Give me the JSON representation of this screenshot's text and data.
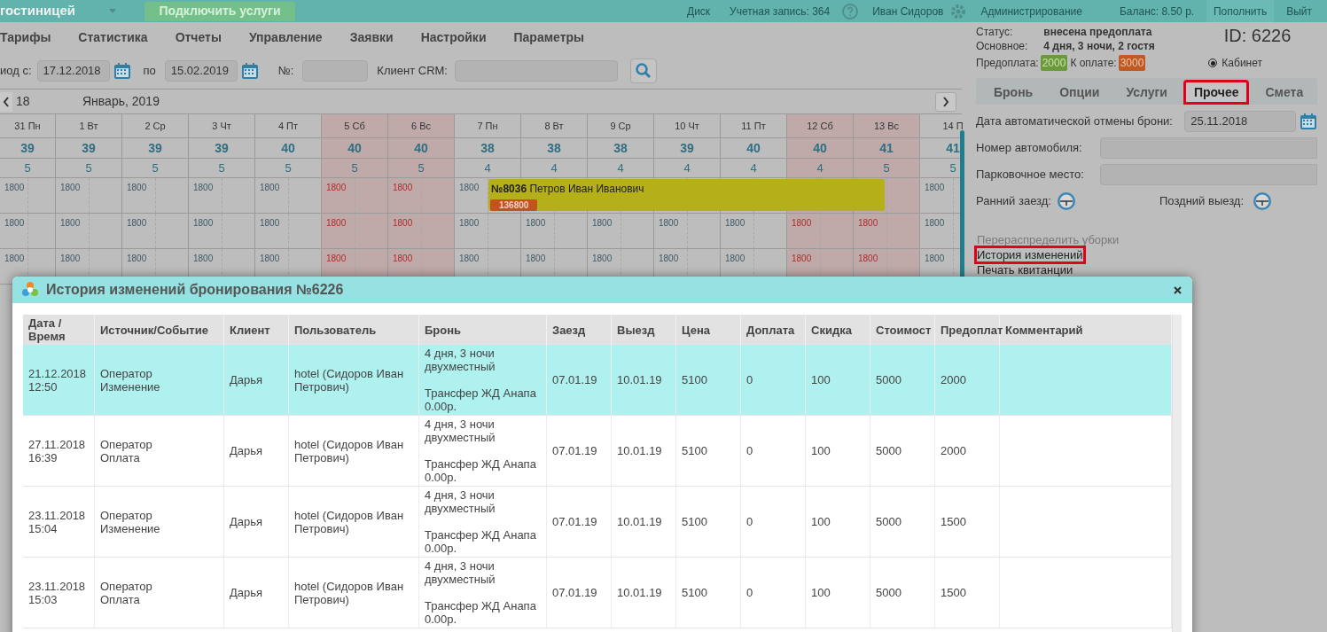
{
  "top_bar": {
    "title": "гостиницей",
    "connect_button": "Подключить услуги",
    "disk": "Диск",
    "account": "Учетная запись: 364",
    "user": "Иван Сидоров",
    "admin": "Администрирование",
    "balance": "Баланс: 8.50 р.",
    "top_up": "Пополнить",
    "logout": "Выйт"
  },
  "menu": [
    "Тарифы",
    "Статистика",
    "Отчеты",
    "Управление",
    "Заявки",
    "Настройки",
    "Параметры"
  ],
  "filter": {
    "period_label": "иод с:",
    "date_from": "17.12.2018",
    "to_label": "по",
    "date_to": "15.02.2019",
    "number_label": "№:",
    "crm_label": "Клиент CRM:"
  },
  "calendar": {
    "year_cut": "18",
    "month": "Январь, 2019",
    "days": [
      {
        "label": "31 Пн",
        "weekend": false,
        "count": "39",
        "free": "5"
      },
      {
        "label": "1 Вт",
        "weekend": false,
        "count": "39",
        "free": "5"
      },
      {
        "label": "2 Ср",
        "weekend": false,
        "count": "39",
        "free": "5"
      },
      {
        "label": "3 Чт",
        "weekend": false,
        "count": "39",
        "free": "5"
      },
      {
        "label": "4 Пт",
        "weekend": false,
        "count": "40",
        "free": "5"
      },
      {
        "label": "5 Сб",
        "weekend": true,
        "count": "40",
        "free": "5"
      },
      {
        "label": "6 Вс",
        "weekend": true,
        "count": "40",
        "free": "5"
      },
      {
        "label": "7 Пн",
        "weekend": false,
        "count": "38",
        "free": "4"
      },
      {
        "label": "8 Вт",
        "weekend": false,
        "count": "38",
        "free": "4"
      },
      {
        "label": "9 Ср",
        "weekend": false,
        "count": "38",
        "free": "4"
      },
      {
        "label": "10 Чт",
        "weekend": false,
        "count": "39",
        "free": "4"
      },
      {
        "label": "11 Пт",
        "weekend": false,
        "count": "40",
        "free": "4"
      },
      {
        "label": "12 Сб",
        "weekend": true,
        "count": "40",
        "free": "4"
      },
      {
        "label": "13 Вс",
        "weekend": true,
        "count": "41",
        "free": "5"
      },
      {
        "label": "14 П",
        "weekend": false,
        "count": "41",
        "free": "5"
      }
    ],
    "price_rows": [
      [
        "1800",
        "1800",
        "1800",
        "1800",
        "1800",
        "1800",
        "1800",
        "1800",
        null,
        null,
        null,
        null,
        null,
        null,
        "1800"
      ],
      [
        "1800",
        "1800",
        "1800",
        "1800",
        "1800",
        "1800",
        "1800",
        "1800",
        "1800",
        "1800",
        "1800",
        "1800",
        "1800",
        "1800",
        "1800"
      ],
      [
        "1800",
        "1800",
        "1800",
        "1800",
        "1800",
        "1800",
        "1800",
        "1800",
        "1800",
        "1800",
        "1800",
        "1800",
        "1800",
        "1800",
        "1800"
      ]
    ],
    "booking": {
      "number": "№8036",
      "guest": "Петров Иван Иванович",
      "amount": "136800"
    }
  },
  "side_panel": {
    "status_label": "Статус:",
    "status": "внесена предоплата",
    "main_label": "Основное:",
    "main": "4 дня, 3 ночи, 2 гостя",
    "prepay_label": "Предоплата:",
    "prepay": "2000",
    "due_label": "К оплате:",
    "due": "3000",
    "id": "ID: 6226",
    "cabinet": {
      "label": "Кабинет",
      "selected": true
    },
    "tabs": [
      {
        "label": "Бронь",
        "selected": false,
        "highlighted": false
      },
      {
        "label": "Опции",
        "selected": false,
        "highlighted": false
      },
      {
        "label": "Услуги",
        "selected": false,
        "highlighted": false
      },
      {
        "label": "Прочее",
        "selected": true,
        "highlighted": true
      },
      {
        "label": "Смета",
        "selected": false,
        "highlighted": false
      }
    ],
    "cancel_label": "Дата автоматической отмены брони:",
    "cancel_date": "25.11.2018",
    "car_label": "Номер автомобиля:",
    "parking_label": "Парковочное место:",
    "early_label": "Ранний заезд:",
    "late_label": "Поздний выезд:",
    "links": [
      {
        "label": "Перераспределить уборки",
        "disabled": true,
        "highlighted": false
      },
      {
        "label": "История изменений",
        "disabled": false,
        "highlighted": true
      },
      {
        "label": "Печать квитанции",
        "disabled": false,
        "highlighted": false
      }
    ]
  },
  "dialog": {
    "title": "История изменений бронирования №6226",
    "columns": [
      "Дата / Время",
      "Источник/Событие",
      "Клиент",
      "Пользователь",
      "Бронь",
      "Заезд",
      "Выезд",
      "Цена",
      "Доплата",
      "Скидка",
      "Стоимост",
      "Предоплат",
      "Комментарий"
    ],
    "rows": [
      {
        "selected": true,
        "date": "21.12.2018",
        "time": "12:50",
        "source": "Оператор",
        "event": "Изменение",
        "client": "Дарья",
        "user": "hotel (Сидоров Иван Петрович)",
        "booking": [
          "4 дня, 3 ночи двухместный",
          "Трансфер ЖД Анапа 0.00р."
        ],
        "checkin": "07.01.19",
        "checkout": "10.01.19",
        "price": "5100",
        "surcharge": "0",
        "discount": "100",
        "cost": "5000",
        "prepay": "2000"
      },
      {
        "selected": false,
        "date": "27.11.2018",
        "time": "16:39",
        "source": "Оператор",
        "event": "Оплата",
        "client": "Дарья",
        "user": "hotel (Сидоров Иван Петрович)",
        "booking": [
          "4 дня, 3 ночи двухместный",
          "Трансфер ЖД Анапа 0.00р."
        ],
        "checkin": "07.01.19",
        "checkout": "10.01.19",
        "price": "5100",
        "surcharge": "0",
        "discount": "100",
        "cost": "5000",
        "prepay": "2000"
      },
      {
        "selected": false,
        "date": "23.11.2018",
        "time": "15:04",
        "source": "Оператор",
        "event": "Изменение",
        "client": "Дарья",
        "user": "hotel (Сидоров Иван Петрович)",
        "booking": [
          "4 дня, 3 ночи двухместный",
          "Трансфер ЖД Анапа 0.00р."
        ],
        "checkin": "07.01.19",
        "checkout": "10.01.19",
        "price": "5100",
        "surcharge": "0",
        "discount": "100",
        "cost": "5000",
        "prepay": "1500"
      },
      {
        "selected": false,
        "date": "23.11.2018",
        "time": "15:03",
        "source": "Оператор",
        "event": "Оплата",
        "client": "Дарья",
        "user": "hotel (Сидоров Иван Петрович)",
        "booking": [
          "4 дня, 3 ночи двухместный",
          "Трансфер ЖД Анапа 0.00р."
        ],
        "checkin": "07.01.19",
        "checkout": "10.01.19",
        "price": "5100",
        "surcharge": "0",
        "discount": "100",
        "cost": "5000",
        "prepay": "1500"
      }
    ]
  }
}
